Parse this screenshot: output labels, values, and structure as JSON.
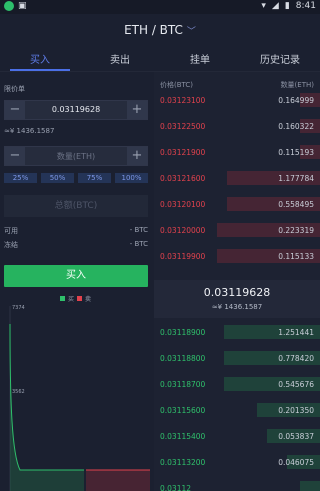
{
  "status_bar": {
    "time": "8:41"
  },
  "header": {
    "title": "ETH / BTC"
  },
  "tabs": [
    {
      "label": "买入",
      "active": true
    },
    {
      "label": "卖出",
      "active": false
    },
    {
      "label": "挂单",
      "active": false
    },
    {
      "label": "历史记录",
      "active": false
    }
  ],
  "form": {
    "price_label": "限价单",
    "price_value": "0.03119628",
    "price_cny": "≈¥ 1436.1587",
    "amount_placeholder": "数量(ETH)",
    "percents": [
      "25%",
      "50%",
      "75%",
      "100%"
    ],
    "total_placeholder": "总额(BTC)",
    "available_label": "可用",
    "available_value": "- BTC",
    "frozen_label": "冻结",
    "frozen_value": "- BTC",
    "buy_label": "买入"
  },
  "depth_chart": {
    "legend_buy": "买",
    "legend_sell": "卖",
    "y_top": "7374",
    "y_mid": "3562"
  },
  "orderbook": {
    "price_header": "价格(BTC)",
    "amount_header": "数量(ETH)",
    "asks": [
      {
        "price": "0.03123100",
        "amount": "0.164999",
        "depth": 0.12
      },
      {
        "price": "0.03122500",
        "amount": "0.160322",
        "depth": 0.12
      },
      {
        "price": "0.03121900",
        "amount": "0.115193",
        "depth": 0.12
      },
      {
        "price": "0.03121600",
        "amount": "1.177784",
        "depth": 0.56
      },
      {
        "price": "0.03120100",
        "amount": "0.558495",
        "depth": 0.56
      },
      {
        "price": "0.03120000",
        "amount": "0.223319",
        "depth": 0.62
      },
      {
        "price": "0.03119900",
        "amount": "0.115133",
        "depth": 0.62
      }
    ],
    "last_price": "0.03119628",
    "last_price_cny": "≈¥ 1436.1587",
    "bids": [
      {
        "price": "0.03118900",
        "amount": "1.251441",
        "depth": 0.58
      },
      {
        "price": "0.03118800",
        "amount": "0.778420",
        "depth": 0.58
      },
      {
        "price": "0.03118700",
        "amount": "0.545676",
        "depth": 0.58
      },
      {
        "price": "0.03115600",
        "amount": "0.201350",
        "depth": 0.38
      },
      {
        "price": "0.03115400",
        "amount": "0.053837",
        "depth": 0.32
      },
      {
        "price": "0.03113200",
        "amount": "0.046075",
        "depth": 0.2
      },
      {
        "price": "0.03112",
        "amount": "",
        "depth": 0.12
      }
    ]
  },
  "colors": {
    "ask": "#e2424d",
    "bid": "#2fc06b",
    "accent": "#4b6fe6",
    "buy_button": "#26b35f"
  }
}
